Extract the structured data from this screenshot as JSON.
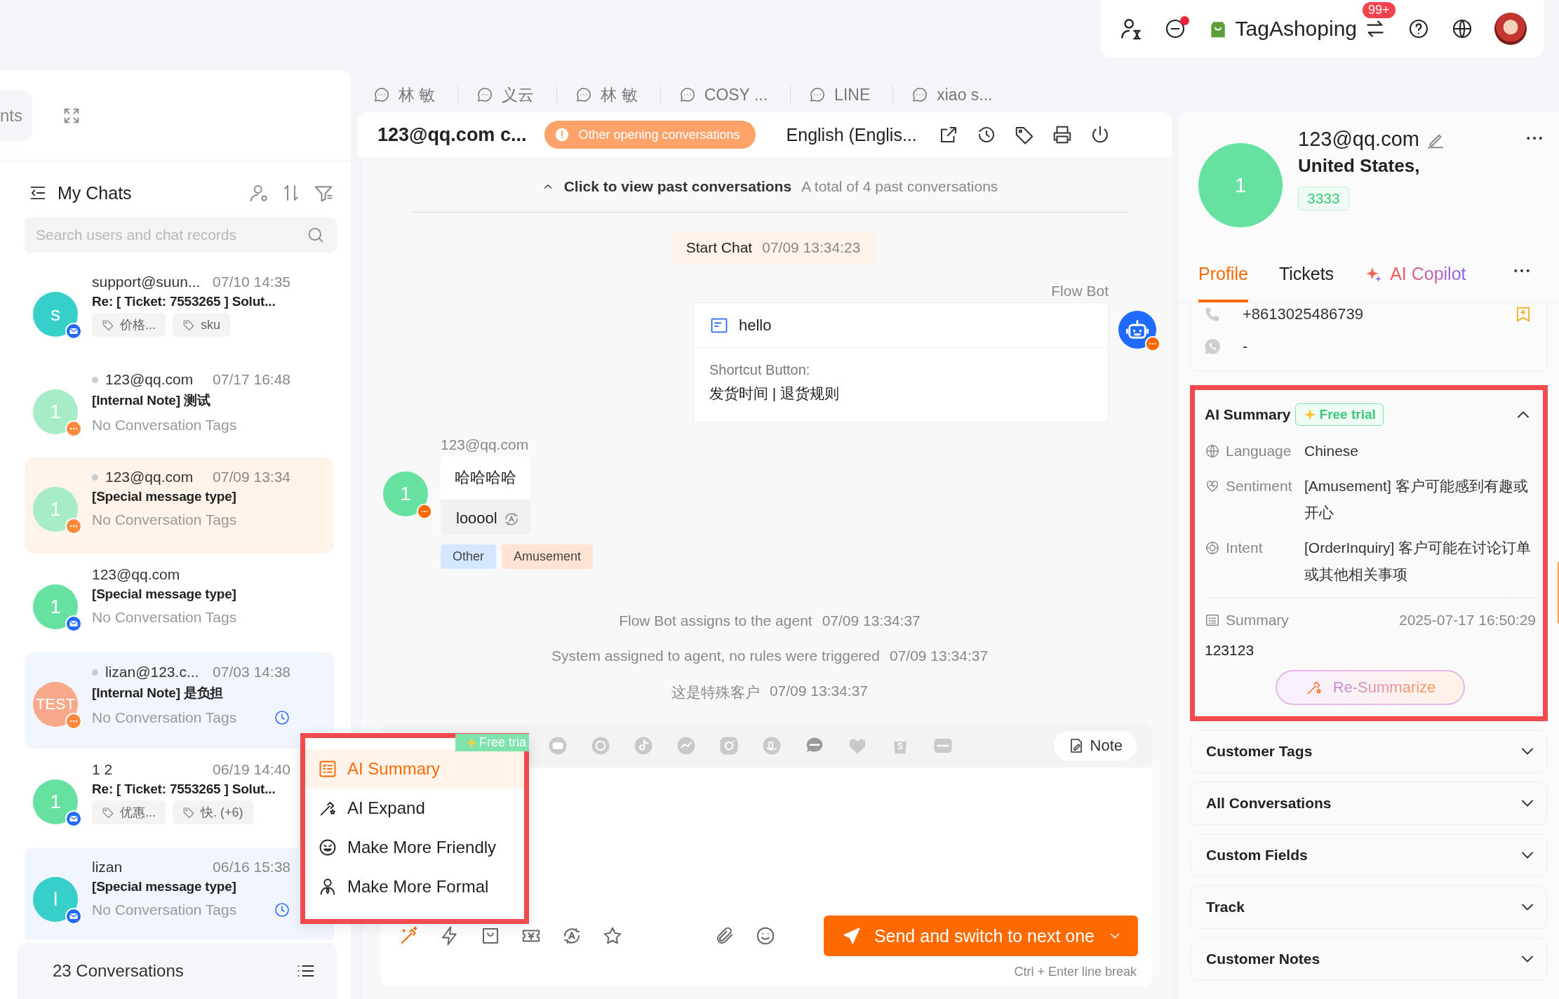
{
  "top_bar": {
    "status_alert": true,
    "store_name": "TagAshoping",
    "notification_badge": "99+"
  },
  "side_nav": {
    "tab_label": "nts"
  },
  "chat_list": {
    "title": "My Chats",
    "search": {
      "placeholder": "Search users and chat records"
    },
    "items": [
      {
        "avatar": "s",
        "color": "#36cfc9",
        "kind": "email",
        "online": false,
        "name": "support@suun...",
        "time": "07/10 14:35",
        "subject": "Re: [ Ticket: 7553265 ] Solut...",
        "tags": [
          "价格...",
          "sku"
        ],
        "selected": false,
        "pending": false
      },
      {
        "avatar": "1",
        "color": "#a6ecc6",
        "kind": "chat",
        "online": true,
        "name": "123@qq.com",
        "time": "07/17 16:48",
        "subject": "[Internal Note] 测试",
        "tag_note": "No Conversation Tags",
        "selected": false,
        "pending": false
      },
      {
        "avatar": "1",
        "color": "#a6ecc6",
        "kind": "chat",
        "online": true,
        "name": "123@qq.com",
        "time": "07/09 13:34",
        "subject": "[Special message type]",
        "tag_note": "No Conversation Tags",
        "selected": true,
        "pending": false
      },
      {
        "avatar": "1",
        "color": "#66e19f",
        "kind": "email",
        "online": false,
        "name": "123@qq.com",
        "subject": "[Special message type]",
        "tag_note": "No Conversation Tags",
        "selected": false,
        "pending": false
      },
      {
        "avatar": "TEST",
        "color": "#f7a98a",
        "kind": "chat",
        "online": true,
        "name": "lizan@123.c...",
        "time": "07/03 14:38",
        "subject": "[Internal Note] 是负担",
        "tag_note": "No Conversation Tags",
        "selected": false,
        "pending": true
      },
      {
        "avatar": "1",
        "color": "#66e19f",
        "kind": "email",
        "online": false,
        "name": "1 2",
        "time": "06/19 14:40",
        "subject": "Re: [ Ticket: 7553265 ] Solut...",
        "tags": [
          "优惠...",
          "快. (+6)"
        ],
        "selected": false,
        "pending": false
      },
      {
        "avatar": "l",
        "color": "#36cfc9",
        "kind": "email",
        "online": false,
        "name": "lizan",
        "time": "06/16 15:38",
        "subject": "[Special message type]",
        "tag_note": "No Conversation Tags",
        "selected": false,
        "pending": true
      }
    ],
    "footer": "23 Conversations"
  },
  "chat_tabs": [
    {
      "label": "林 敏",
      "selected": false
    },
    {
      "label": "义云",
      "selected": false
    },
    {
      "label": "林 敏",
      "selected": false
    },
    {
      "label": "COSY ...",
      "selected": false
    },
    {
      "label": "LINE",
      "selected": false
    },
    {
      "label": "xiao s...",
      "selected": false
    }
  ],
  "conversation": {
    "title": "123@qq.com c...",
    "alert": "Other opening conversations",
    "language": "English (Englis...",
    "messages": [
      {
        "kind": "history",
        "link": "Click to view past conversations",
        "note": "A total of 4 past conversations"
      },
      {
        "kind": "start",
        "label": "Start Chat",
        "time": "07/09 13:34:23"
      },
      {
        "kind": "bot_card",
        "sender": "Flow Bot",
        "title": "hello",
        "label": "Shortcut Button:",
        "text": "发货时间 | 退货规则"
      },
      {
        "kind": "customer",
        "sender": "123@qq.com",
        "avatar": "1",
        "color": "#66e19f",
        "bubbles": [
          "哈哈哈哈",
          "looool"
        ],
        "tags": [
          {
            "label": "Other",
            "color": "#d5e7ff"
          },
          {
            "label": "Amusement",
            "color": "#ffe3d2"
          }
        ]
      },
      {
        "kind": "system",
        "text": "Flow Bot assigns to the agent",
        "time": "07/09 13:34:37"
      },
      {
        "kind": "system",
        "text": "System assigned to agent, no rules were triggered",
        "time": "07/09 13:34:37"
      },
      {
        "kind": "system",
        "text": "这是特殊客户",
        "time": "07/09 13:34:37"
      }
    ]
  },
  "composer": {
    "note_button": "Note",
    "ai_tool_active": true,
    "send_button": "Send and switch to next one",
    "hint": "Ctrl + Enter line break"
  },
  "ai_menu": {
    "badge": "Free tria",
    "items": [
      {
        "label": "AI Summary",
        "selected": true
      },
      {
        "label": "AI Expand",
        "selected": false
      },
      {
        "label": "Make More Friendly",
        "selected": false
      },
      {
        "label": "Make More Formal",
        "selected": false
      }
    ]
  },
  "profile": {
    "avatar": "1",
    "email": "123@qq.com",
    "location": "United States,",
    "tag": "3333",
    "tabs": [
      {
        "label": "Profile",
        "kind": "plain",
        "selected": true
      },
      {
        "label": "Tickets",
        "kind": "plain",
        "selected": false
      },
      {
        "label": "AI Copilot",
        "kind": "ai",
        "selected": false
      }
    ],
    "contacts": [
      {
        "kind": "phone",
        "value": "+8613025486739"
      },
      {
        "kind": "whatsapp",
        "value": "-"
      }
    ],
    "ai_summary": {
      "title": "AI Summary",
      "badge": "Free trial",
      "expanded": true,
      "rows": [
        {
          "label": "Language",
          "value": "Chinese"
        },
        {
          "label": "Sentiment",
          "value": "[Amusement] 客户可能感到有趣或开心"
        },
        {
          "label": "Intent",
          "value": "[OrderInquiry] 客户可能在讨论订单或其他相关事项"
        }
      ],
      "summary_label": "Summary",
      "summary_time": "2025-07-17 16:50:29",
      "summary": "123123",
      "button": "Re-Summarize"
    },
    "sections": [
      {
        "title": "Customer Tags",
        "expanded": false
      },
      {
        "title": "All Conversations",
        "expanded": false
      },
      {
        "title": "Custom Fields",
        "expanded": false
      },
      {
        "title": "Track",
        "expanded": false
      },
      {
        "title": "Customer Notes",
        "expanded": false
      }
    ]
  }
}
